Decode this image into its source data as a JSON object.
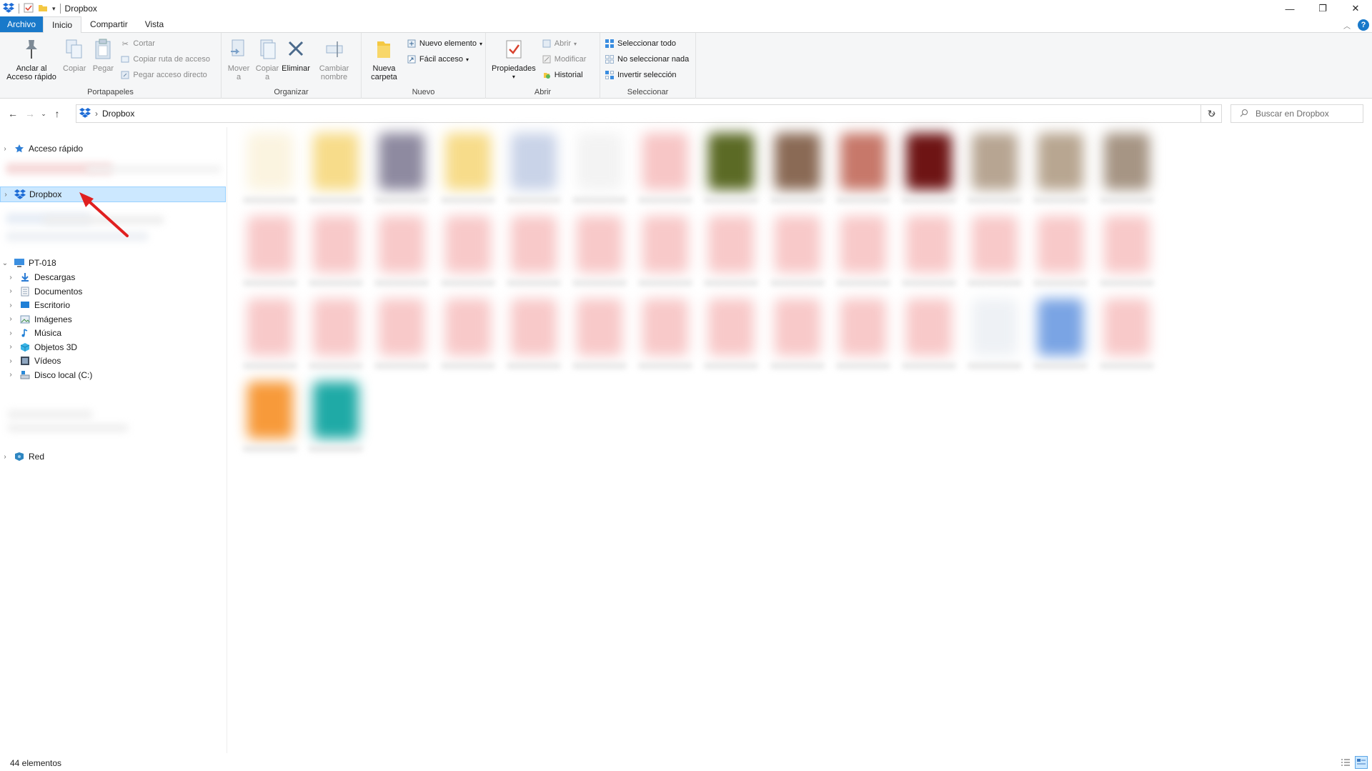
{
  "window": {
    "title": "Dropbox",
    "minimize_symbol": "—",
    "restore_symbol": "❐",
    "close_symbol": "✕"
  },
  "tabs": {
    "file": "Archivo",
    "home": "Inicio",
    "share": "Compartir",
    "view": "Vista"
  },
  "ribbon": {
    "clipboard": {
      "label": "Portapapeles",
      "pin": "Anclar al Acceso rápido",
      "copy": "Copiar",
      "paste": "Pegar",
      "cut": "Cortar",
      "copy_path": "Copiar ruta de acceso",
      "paste_shortcut": "Pegar acceso directo"
    },
    "organize": {
      "label": "Organizar",
      "move_to": "Mover a",
      "copy_to": "Copiar a",
      "delete": "Eliminar",
      "rename": "Cambiar nombre"
    },
    "new": {
      "label": "Nuevo",
      "new_folder": "Nueva carpeta",
      "new_item": "Nuevo elemento",
      "easy_access": "Fácil acceso"
    },
    "open": {
      "label": "Abrir",
      "properties": "Propiedades",
      "open": "Abrir",
      "edit": "Modificar",
      "history": "Historial"
    },
    "select": {
      "label": "Seleccionar",
      "select_all": "Seleccionar todo",
      "select_none": "No seleccionar nada",
      "invert": "Invertir selección"
    }
  },
  "address": {
    "path": "Dropbox",
    "search_placeholder": "Buscar en Dropbox"
  },
  "navpane": {
    "quick_access": "Acceso rápido",
    "dropbox": "Dropbox",
    "pc": "PT-018",
    "pc_items": [
      {
        "label": "Descargas",
        "icon": "downloads-icon"
      },
      {
        "label": "Documentos",
        "icon": "documents-icon"
      },
      {
        "label": "Escritorio",
        "icon": "desktop-icon"
      },
      {
        "label": "Imágenes",
        "icon": "pictures-icon"
      },
      {
        "label": "Música",
        "icon": "music-icon"
      },
      {
        "label": "Objetos 3D",
        "icon": "3d-objects-icon"
      },
      {
        "label": "Vídeos",
        "icon": "videos-icon"
      },
      {
        "label": "Disco local (C:)",
        "icon": "local-disk-icon"
      }
    ],
    "network": "Red"
  },
  "content": {
    "tile_colors": {
      "row1": [
        "#fbf4e0",
        "#f7dc8a",
        "#8e8aa0",
        "#f7dc8a",
        "#c9d3e8",
        "#f3f3f3",
        "#f7c6c6",
        "#5b6a25",
        "#8a6a55",
        "#c7786a",
        "#6e1414",
        "#b7a592",
        "#b8a691",
        "#a69584"
      ],
      "pdf": "#f8c9c9",
      "row3_extra": [
        "#eef1f5",
        "#7aa4e4"
      ],
      "row4": [
        "#f79a3a",
        "#1faaa6"
      ]
    }
  },
  "statusbar": {
    "count": "44 elementos"
  },
  "annotation": {
    "arrow_color": "#e02020"
  }
}
